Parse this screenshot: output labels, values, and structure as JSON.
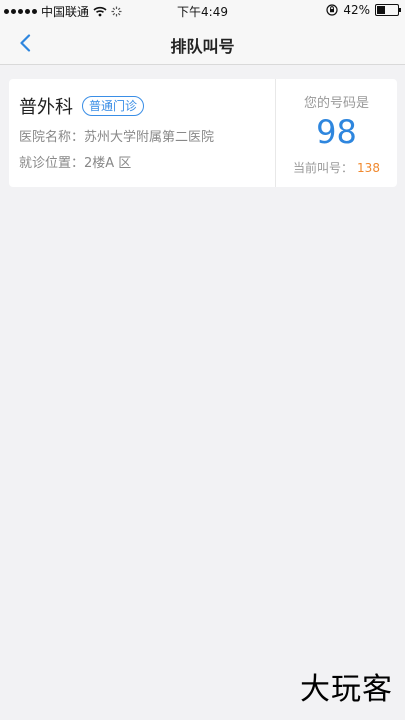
{
  "status_bar": {
    "carrier": "中国联通",
    "time": "下午4:49",
    "battery": "42%",
    "battery_level": 0.42
  },
  "nav": {
    "title": "排队叫号"
  },
  "card": {
    "department": "普外科",
    "clinic_type": "普通门诊",
    "hospital": "医院名称：苏州大学附属第二医院",
    "location": "就诊位置：2楼A 区",
    "your_number_label": "您的号码是",
    "your_number": "98",
    "current_call_label": "当前叫号：",
    "current_call_value": "138"
  },
  "watermark": "大玩客",
  "colors": {
    "accent_blue": "#2e86de",
    "current_call_orange": "#f0892f"
  }
}
